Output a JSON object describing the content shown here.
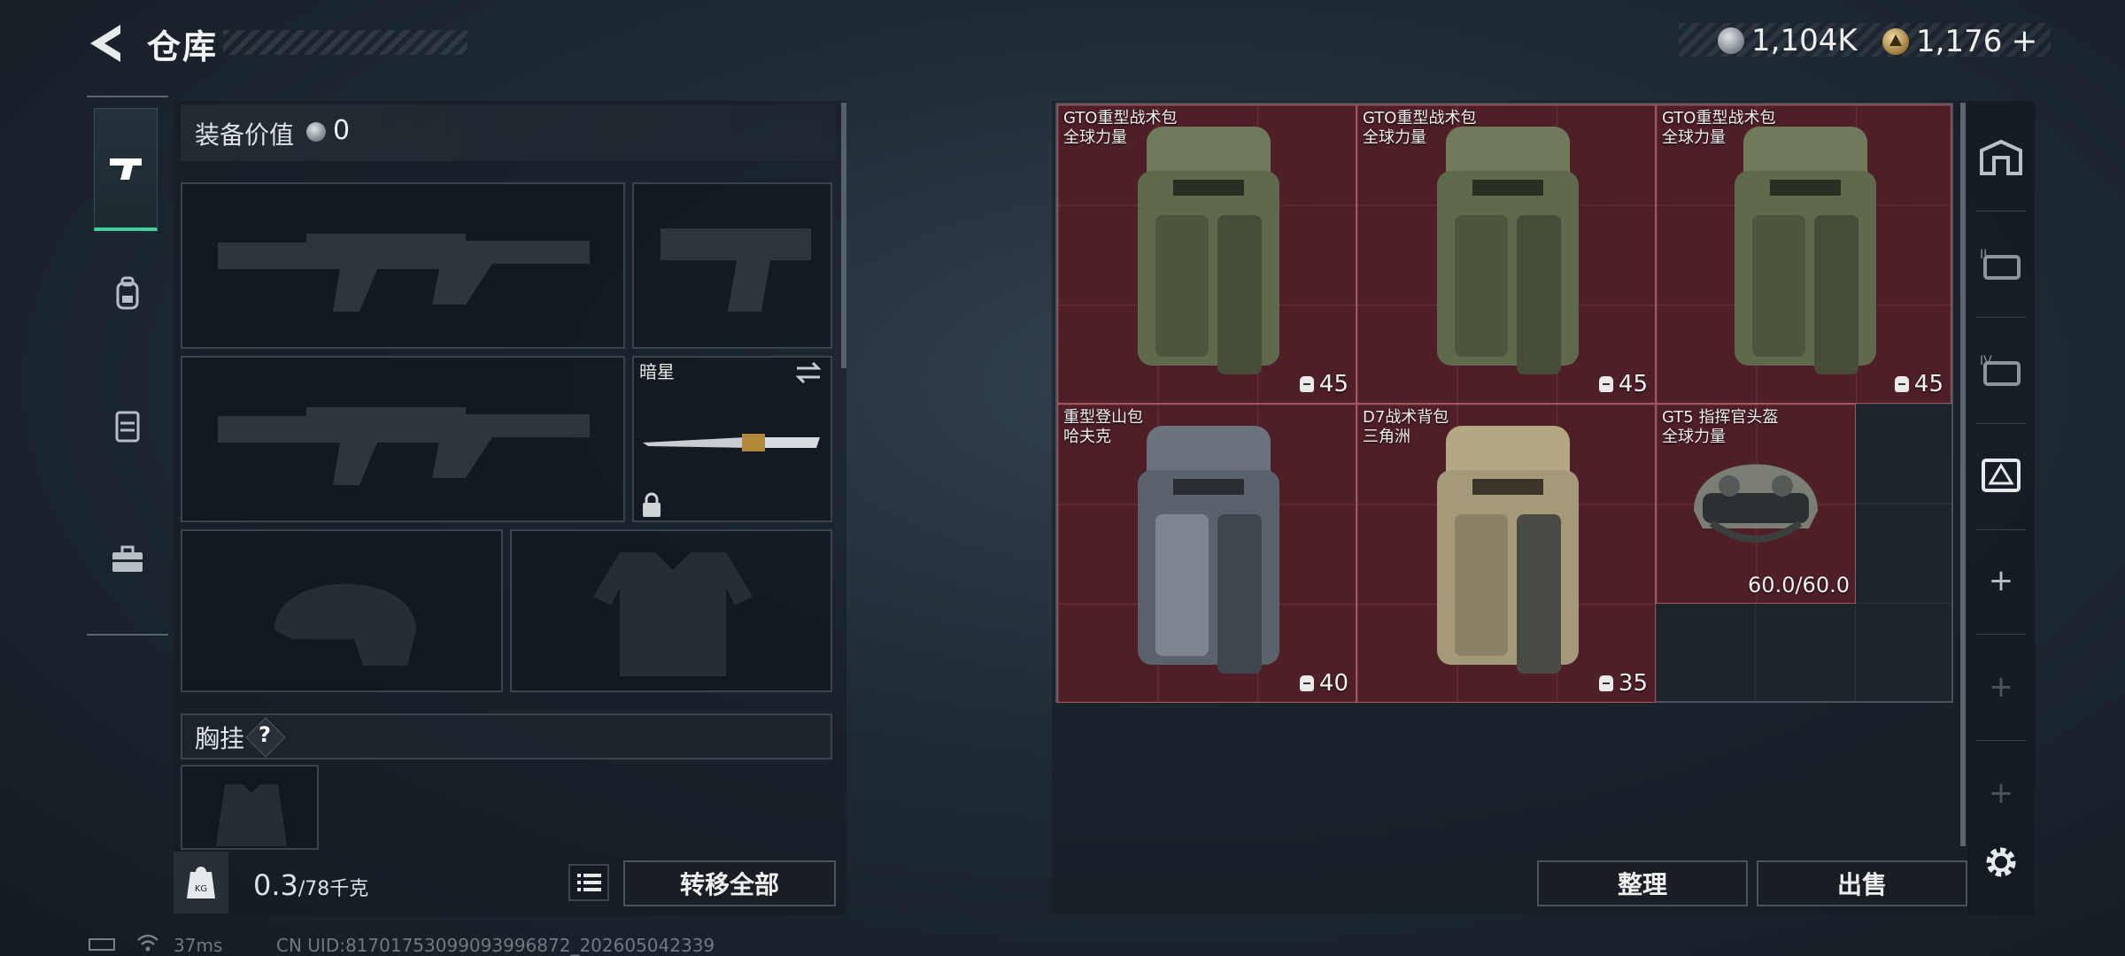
{
  "header": {
    "title": "仓库",
    "currency_silver": "1,104K",
    "currency_gold": "1,176",
    "currency_gold_plus": "+"
  },
  "left_rail": {
    "items": [
      {
        "icon": "pistol-icon",
        "active": true
      },
      {
        "icon": "backpack-icon",
        "active": false
      },
      {
        "icon": "vest-icon",
        "active": false
      },
      {
        "icon": "toolbox-icon",
        "active": false
      }
    ]
  },
  "equipment": {
    "value_label": "装备价值",
    "value": "0",
    "melee_name": "暗星",
    "chest_rig_label": "胸挂",
    "chest_rig_help": "?",
    "weight_current": "0.3",
    "weight_max": "/78千克",
    "transfer_all_label": "转移全部"
  },
  "storage": {
    "items": [
      {
        "name_line1": "GTO重型战术包",
        "name_line2": "全球力量",
        "count": "45",
        "color": "#6f7a5a"
      },
      {
        "name_line1": "GTO重型战术包",
        "name_line2": "全球力量",
        "count": "45",
        "color": "#6f7a5a"
      },
      {
        "name_line1": "GTO重型战术包",
        "name_line2": "全球力量",
        "count": "45",
        "color": "#6f7a5a"
      },
      {
        "name_line1": "重型登山包",
        "name_line2": "哈夫克",
        "count": "40",
        "color": "#6a727c"
      },
      {
        "name_line1": "D7战术背包",
        "name_line2": "三角洲",
        "count": "35",
        "color": "#a49a7a"
      },
      {
        "name_line1": "GT5 指挥官头盔",
        "name_line2": "全球力量",
        "durability": "60.0/60.0",
        "color": "#7a7e74"
      }
    ],
    "sort_label": "整理",
    "sell_label": "出售"
  },
  "right_rail": {
    "items": [
      "home-case-icon",
      "case-ii-icon",
      "case-iv-icon",
      "case-ii-triangle-icon"
    ],
    "plus": "+"
  },
  "status": {
    "ping": "37ms",
    "uid": "CN UID:81701753099093996872_202605042339"
  },
  "colors": {
    "accent_green": "#3bd39a",
    "item_red": "#6e1e26"
  }
}
